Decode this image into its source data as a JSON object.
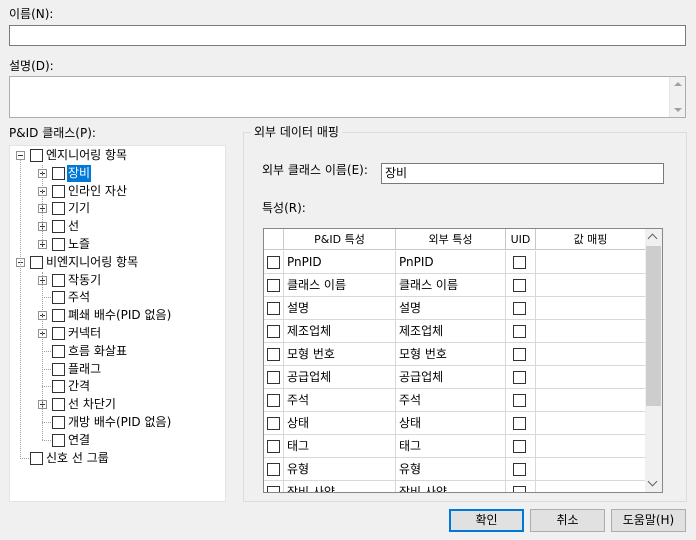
{
  "form": {
    "name_label": "이름(N):",
    "name_value": "",
    "description_label": "설명(D):",
    "description_value": ""
  },
  "tree": {
    "label": "P&ID 클래스(P):",
    "items": [
      {
        "text": "엔지니어링 항목",
        "level": 0,
        "expander": "minus"
      },
      {
        "text": "장비",
        "level": 1,
        "expander": "plus",
        "selected": true
      },
      {
        "text": "인라인 자산",
        "level": 1,
        "expander": "plus"
      },
      {
        "text": "기기",
        "level": 1,
        "expander": "plus"
      },
      {
        "text": "선",
        "level": 1,
        "expander": "plus"
      },
      {
        "text": "노즐",
        "level": 1,
        "expander": "plus"
      },
      {
        "text": "비엔지니어링 항목",
        "level": 0,
        "expander": "minus"
      },
      {
        "text": "작동기",
        "level": 1,
        "expander": "plus"
      },
      {
        "text": "주석",
        "level": 1,
        "expander": "none"
      },
      {
        "text": "폐쇄 배수(PID 없음)",
        "level": 1,
        "expander": "plus"
      },
      {
        "text": "커넥터",
        "level": 1,
        "expander": "plus"
      },
      {
        "text": "흐름 화살표",
        "level": 1,
        "expander": "none"
      },
      {
        "text": "플래그",
        "level": 1,
        "expander": "none"
      },
      {
        "text": "간격",
        "level": 1,
        "expander": "none"
      },
      {
        "text": "선 차단기",
        "level": 1,
        "expander": "plus"
      },
      {
        "text": "개방 배수(PID 없음)",
        "level": 1,
        "expander": "none"
      },
      {
        "text": "연결",
        "level": 1,
        "expander": "none"
      },
      {
        "text": "신호 선 그룹",
        "level": 0,
        "expander": "none"
      }
    ]
  },
  "mapping": {
    "group_title": "외부 데이터 매핑",
    "ext_class_label": "외부 클래스 이름(E):",
    "ext_class_value": "장비",
    "properties_label": "특성(R):",
    "columns": [
      "",
      "P&ID 특성",
      "외부 특성",
      "UID",
      "값 매핑"
    ],
    "rows": [
      [
        "PnPID",
        "PnPID"
      ],
      [
        "클래스 이름",
        "클래스 이름"
      ],
      [
        "설명",
        "설명"
      ],
      [
        "제조업체",
        "제조업체"
      ],
      [
        "모형 번호",
        "모형 번호"
      ],
      [
        "공급업체",
        "공급업체"
      ],
      [
        "주석",
        "주석"
      ],
      [
        "상태",
        "상태"
      ],
      [
        "태그",
        "태그"
      ],
      [
        "유형",
        "유형"
      ],
      [
        "장비 사양",
        "장비 사양"
      ]
    ]
  },
  "buttons": {
    "ok": "확인",
    "cancel": "취소",
    "help": "도움말(H)"
  }
}
